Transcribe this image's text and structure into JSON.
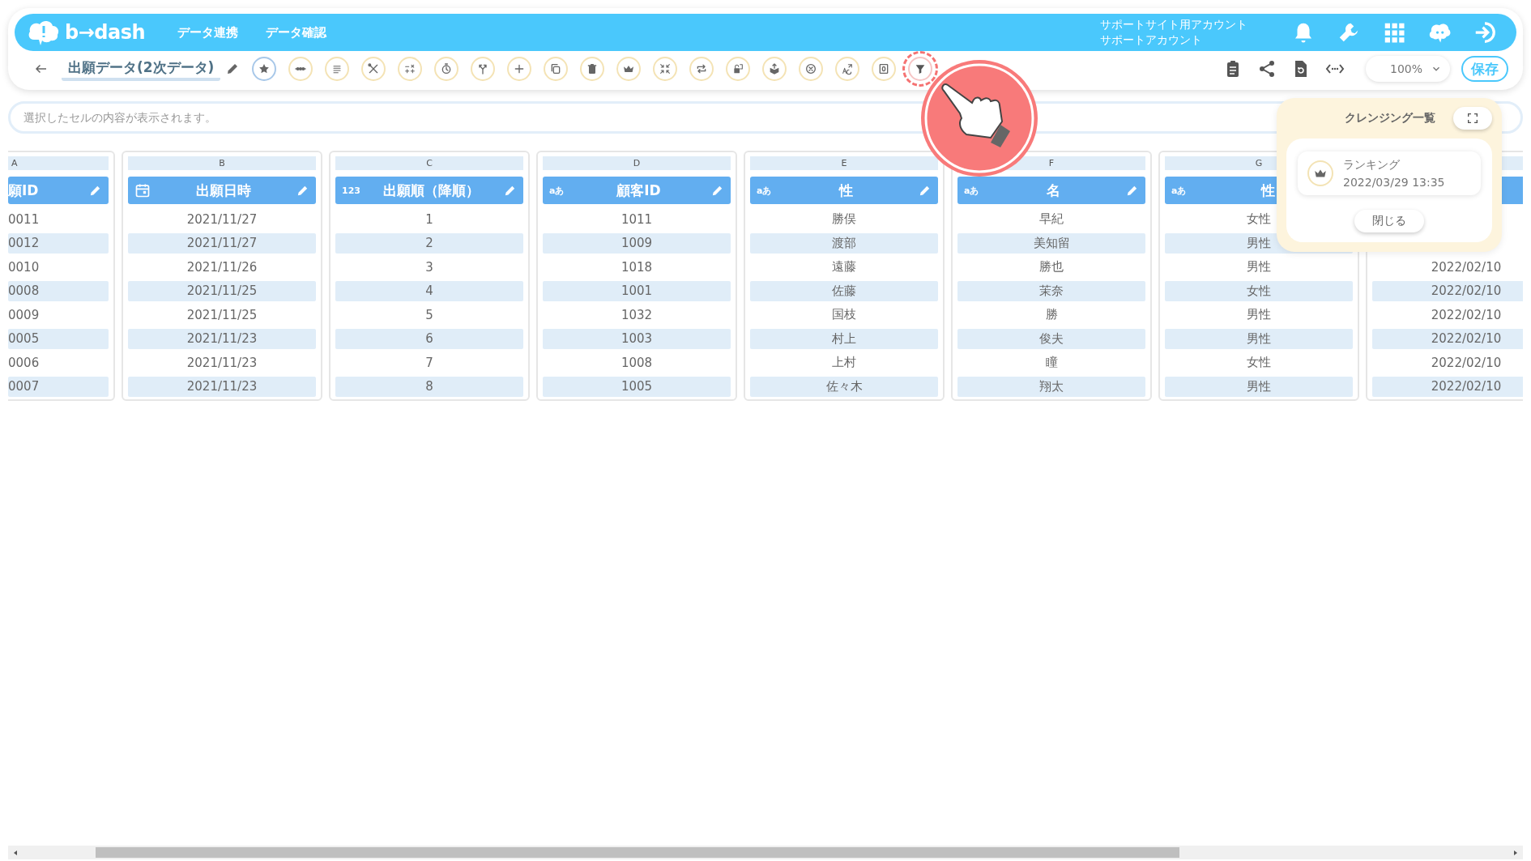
{
  "header": {
    "logo": "b→dash",
    "nav": [
      {
        "label": "データ連携"
      },
      {
        "label": "データ確認"
      }
    ],
    "account": [
      "サポートサイト用アカウント",
      "サポートアカウント"
    ]
  },
  "toolbar": {
    "title": "出願データ(2次データ)",
    "tools": [
      {
        "selected": true,
        "highlighted": false
      },
      {
        "selected": false,
        "highlighted": false
      },
      {
        "selected": false,
        "highlighted": false
      },
      {
        "selected": false,
        "highlighted": false
      },
      {
        "selected": false,
        "highlighted": false
      },
      {
        "selected": false,
        "highlighted": false
      },
      {
        "selected": false,
        "highlighted": false
      },
      {
        "selected": false,
        "highlighted": false
      },
      {
        "selected": false,
        "highlighted": false
      },
      {
        "selected": false,
        "highlighted": false
      },
      {
        "selected": false,
        "highlighted": false
      },
      {
        "selected": false,
        "highlighted": false
      },
      {
        "selected": false,
        "highlighted": false
      },
      {
        "selected": false,
        "highlighted": false
      },
      {
        "selected": false,
        "highlighted": false
      },
      {
        "selected": false,
        "highlighted": false
      },
      {
        "selected": false,
        "highlighted": false
      },
      {
        "selected": false,
        "highlighted": false
      },
      {
        "selected": false,
        "highlighted": true
      }
    ],
    "zoom": "100%",
    "save": "保存"
  },
  "cell_bar": {
    "placeholder": "選択したセルの内容が表示されます。"
  },
  "sheet": {
    "columns": [
      {
        "letter": "A",
        "title": "願ID",
        "editable": true,
        "cells": [
          "0011",
          "0012",
          "0010",
          "0008",
          "0009",
          "0005",
          "0006",
          "0007"
        ]
      },
      {
        "letter": "B",
        "kind": "date",
        "title": "出願日時",
        "editable": true,
        "cells": [
          "2021/11/27",
          "2021/11/27",
          "2021/11/26",
          "2021/11/25",
          "2021/11/25",
          "2021/11/23",
          "2021/11/23",
          "2021/11/23"
        ]
      },
      {
        "letter": "C",
        "kind": "number",
        "type_label": "123",
        "title": "出願順（降順）",
        "editable": true,
        "cells": [
          "1",
          "2",
          "3",
          "4",
          "5",
          "6",
          "7",
          "8"
        ]
      },
      {
        "letter": "D",
        "kind": "text",
        "type_label": "aあ",
        "title": "顧客ID",
        "editable": true,
        "cells": [
          "1011",
          "1009",
          "1018",
          "1001",
          "1032",
          "1003",
          "1008",
          "1005"
        ]
      },
      {
        "letter": "E",
        "kind": "text",
        "type_label": "aあ",
        "title": "性",
        "editable": true,
        "cells": [
          "勝俣",
          "渡部",
          "遠藤",
          "佐藤",
          "国枝",
          "村上",
          "上村",
          "佐々木"
        ]
      },
      {
        "letter": "F",
        "kind": "text",
        "type_label": "aあ",
        "title": "名",
        "editable": true,
        "cells": [
          "早紀",
          "美知留",
          "勝也",
          "茉奈",
          "勝",
          "俊夫",
          "瞳",
          "翔太"
        ]
      },
      {
        "letter": "G",
        "kind": "text",
        "type_label": "aあ",
        "title": "性",
        "editable": false,
        "cells": [
          "女性",
          "男性",
          "男性",
          "女性",
          "男性",
          "男性",
          "女性",
          "男性"
        ]
      },
      {
        "cells": [
          "2022/02/10",
          "2022/02/10",
          "2022/02/10",
          "2022/02/10",
          "2022/02/10",
          "2022/02/10"
        ]
      }
    ]
  },
  "cleansing_panel": {
    "title": "クレンジング一覧",
    "items": [
      {
        "name": "ランキング",
        "time": "2022/03/29 13:35"
      }
    ],
    "close": "閉じる"
  }
}
